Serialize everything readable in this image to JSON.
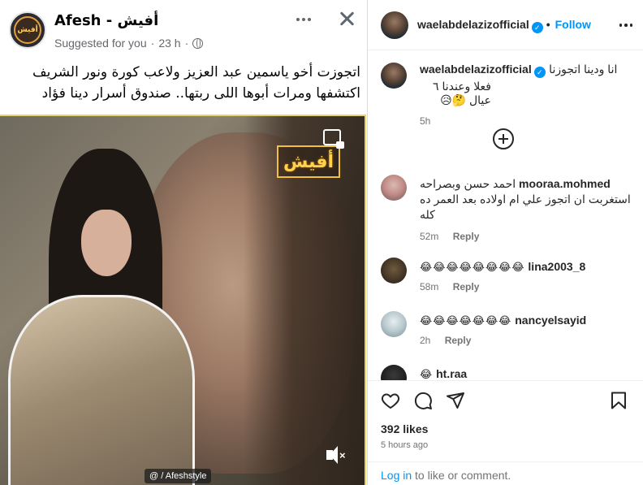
{
  "facebook_post": {
    "page_name": "Afesh - أفيش",
    "avatar_text": "أفيش",
    "suggested": "Suggested for you",
    "time": "23 h",
    "text_line1": "اتجوزت أخو ياسمين عبد العزيز ولاعب كورة ونور الشريف",
    "text_line2": "اكتشفها ومرات أبوها اللى ربتها.. صندوق أسرار دينا فؤاد",
    "image": {
      "watermark": "أفيش",
      "footer": "@ / Afeshstyle"
    }
  },
  "instagram": {
    "header": {
      "username": "waelabdelazizofficial",
      "separator": "•",
      "follow_label": "Follow"
    },
    "caption": {
      "username": "waelabdelazizofficial",
      "line1": "انا ودينا اتجوزنا",
      "line2": "فعلا وعندنا ٦ عيال 🤔😥",
      "time": "5h"
    },
    "comments": [
      {
        "username": "mooraa.mohmed",
        "text": "احمد حسن وبصراحه استغربت ان اتجوز علي ام اولاده بعد العمر ده كله",
        "time": "52m",
        "reply": "Reply"
      },
      {
        "username": "lina2003_8",
        "text": "😂😂😂😂😂😂😂😂",
        "time": "58m",
        "reply": "Reply"
      },
      {
        "username": "nancyelsayid",
        "text": "😂😂😂😂😂😂😂",
        "time": "2h",
        "reply": "Reply"
      },
      {
        "username": "ht.raa",
        "text": "😂",
        "time": "",
        "reply": ""
      }
    ],
    "likes": "392 likes",
    "posted": "5 hours ago",
    "login_link": "Log in",
    "login_rest": " to like or comment."
  },
  "colors": {
    "link_blue": "#0095f6",
    "text_dark": "#262626",
    "text_muted": "#737373",
    "fb_text": "#050505",
    "fb_muted": "#65676b",
    "image_border": "#e8d36a"
  }
}
